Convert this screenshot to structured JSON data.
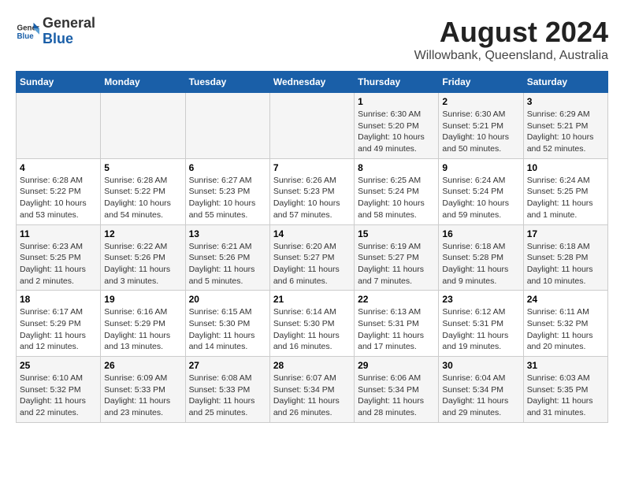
{
  "header": {
    "logo_general": "General",
    "logo_blue": "Blue",
    "month_year": "August 2024",
    "location": "Willowbank, Queensland, Australia"
  },
  "days_of_week": [
    "Sunday",
    "Monday",
    "Tuesday",
    "Wednesday",
    "Thursday",
    "Friday",
    "Saturday"
  ],
  "weeks": [
    {
      "days": [
        {
          "number": "",
          "info": ""
        },
        {
          "number": "",
          "info": ""
        },
        {
          "number": "",
          "info": ""
        },
        {
          "number": "",
          "info": ""
        },
        {
          "number": "1",
          "info": "Sunrise: 6:30 AM\nSunset: 5:20 PM\nDaylight: 10 hours\nand 49 minutes."
        },
        {
          "number": "2",
          "info": "Sunrise: 6:30 AM\nSunset: 5:21 PM\nDaylight: 10 hours\nand 50 minutes."
        },
        {
          "number": "3",
          "info": "Sunrise: 6:29 AM\nSunset: 5:21 PM\nDaylight: 10 hours\nand 52 minutes."
        }
      ]
    },
    {
      "days": [
        {
          "number": "4",
          "info": "Sunrise: 6:28 AM\nSunset: 5:22 PM\nDaylight: 10 hours\nand 53 minutes."
        },
        {
          "number": "5",
          "info": "Sunrise: 6:28 AM\nSunset: 5:22 PM\nDaylight: 10 hours\nand 54 minutes."
        },
        {
          "number": "6",
          "info": "Sunrise: 6:27 AM\nSunset: 5:23 PM\nDaylight: 10 hours\nand 55 minutes."
        },
        {
          "number": "7",
          "info": "Sunrise: 6:26 AM\nSunset: 5:23 PM\nDaylight: 10 hours\nand 57 minutes."
        },
        {
          "number": "8",
          "info": "Sunrise: 6:25 AM\nSunset: 5:24 PM\nDaylight: 10 hours\nand 58 minutes."
        },
        {
          "number": "9",
          "info": "Sunrise: 6:24 AM\nSunset: 5:24 PM\nDaylight: 10 hours\nand 59 minutes."
        },
        {
          "number": "10",
          "info": "Sunrise: 6:24 AM\nSunset: 5:25 PM\nDaylight: 11 hours\nand 1 minute."
        }
      ]
    },
    {
      "days": [
        {
          "number": "11",
          "info": "Sunrise: 6:23 AM\nSunset: 5:25 PM\nDaylight: 11 hours\nand 2 minutes."
        },
        {
          "number": "12",
          "info": "Sunrise: 6:22 AM\nSunset: 5:26 PM\nDaylight: 11 hours\nand 3 minutes."
        },
        {
          "number": "13",
          "info": "Sunrise: 6:21 AM\nSunset: 5:26 PM\nDaylight: 11 hours\nand 5 minutes."
        },
        {
          "number": "14",
          "info": "Sunrise: 6:20 AM\nSunset: 5:27 PM\nDaylight: 11 hours\nand 6 minutes."
        },
        {
          "number": "15",
          "info": "Sunrise: 6:19 AM\nSunset: 5:27 PM\nDaylight: 11 hours\nand 7 minutes."
        },
        {
          "number": "16",
          "info": "Sunrise: 6:18 AM\nSunset: 5:28 PM\nDaylight: 11 hours\nand 9 minutes."
        },
        {
          "number": "17",
          "info": "Sunrise: 6:18 AM\nSunset: 5:28 PM\nDaylight: 11 hours\nand 10 minutes."
        }
      ]
    },
    {
      "days": [
        {
          "number": "18",
          "info": "Sunrise: 6:17 AM\nSunset: 5:29 PM\nDaylight: 11 hours\nand 12 minutes."
        },
        {
          "number": "19",
          "info": "Sunrise: 6:16 AM\nSunset: 5:29 PM\nDaylight: 11 hours\nand 13 minutes."
        },
        {
          "number": "20",
          "info": "Sunrise: 6:15 AM\nSunset: 5:30 PM\nDaylight: 11 hours\nand 14 minutes."
        },
        {
          "number": "21",
          "info": "Sunrise: 6:14 AM\nSunset: 5:30 PM\nDaylight: 11 hours\nand 16 minutes."
        },
        {
          "number": "22",
          "info": "Sunrise: 6:13 AM\nSunset: 5:31 PM\nDaylight: 11 hours\nand 17 minutes."
        },
        {
          "number": "23",
          "info": "Sunrise: 6:12 AM\nSunset: 5:31 PM\nDaylight: 11 hours\nand 19 minutes."
        },
        {
          "number": "24",
          "info": "Sunrise: 6:11 AM\nSunset: 5:32 PM\nDaylight: 11 hours\nand 20 minutes."
        }
      ]
    },
    {
      "days": [
        {
          "number": "25",
          "info": "Sunrise: 6:10 AM\nSunset: 5:32 PM\nDaylight: 11 hours\nand 22 minutes."
        },
        {
          "number": "26",
          "info": "Sunrise: 6:09 AM\nSunset: 5:33 PM\nDaylight: 11 hours\nand 23 minutes."
        },
        {
          "number": "27",
          "info": "Sunrise: 6:08 AM\nSunset: 5:33 PM\nDaylight: 11 hours\nand 25 minutes."
        },
        {
          "number": "28",
          "info": "Sunrise: 6:07 AM\nSunset: 5:34 PM\nDaylight: 11 hours\nand 26 minutes."
        },
        {
          "number": "29",
          "info": "Sunrise: 6:06 AM\nSunset: 5:34 PM\nDaylight: 11 hours\nand 28 minutes."
        },
        {
          "number": "30",
          "info": "Sunrise: 6:04 AM\nSunset: 5:34 PM\nDaylight: 11 hours\nand 29 minutes."
        },
        {
          "number": "31",
          "info": "Sunrise: 6:03 AM\nSunset: 5:35 PM\nDaylight: 11 hours\nand 31 minutes."
        }
      ]
    }
  ]
}
